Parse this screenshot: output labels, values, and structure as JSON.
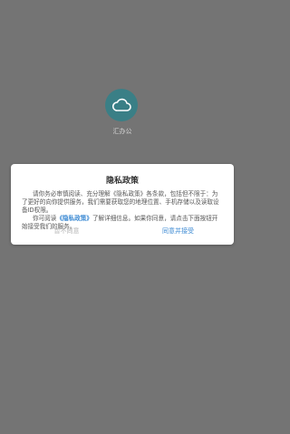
{
  "app": {
    "name": "汇办公",
    "logo_icon": "cloud-icon",
    "logo_color": "#3a7f86"
  },
  "dialog": {
    "title": "隐私政策",
    "paragraph1": "请你务必审慎阅读、充分理解《隐私政策》各条款，包括但不限于：为了更好的向你提供服务，我们需要获取您的地理位置、手机存储以及读取设备ID权限。",
    "paragraph2_prefix": "你可阅读",
    "policy_link": "《隐私政策》",
    "paragraph2_suffix": "了解详细信息。如果你同意，请点击下面按钮开始接受我们的服务。",
    "disagree_label": "暂不同意",
    "agree_label": "同意并接受"
  },
  "colors": {
    "overlay": "#747474",
    "link": "#3c8ad3",
    "disagree_text": "#b3b3b3"
  }
}
